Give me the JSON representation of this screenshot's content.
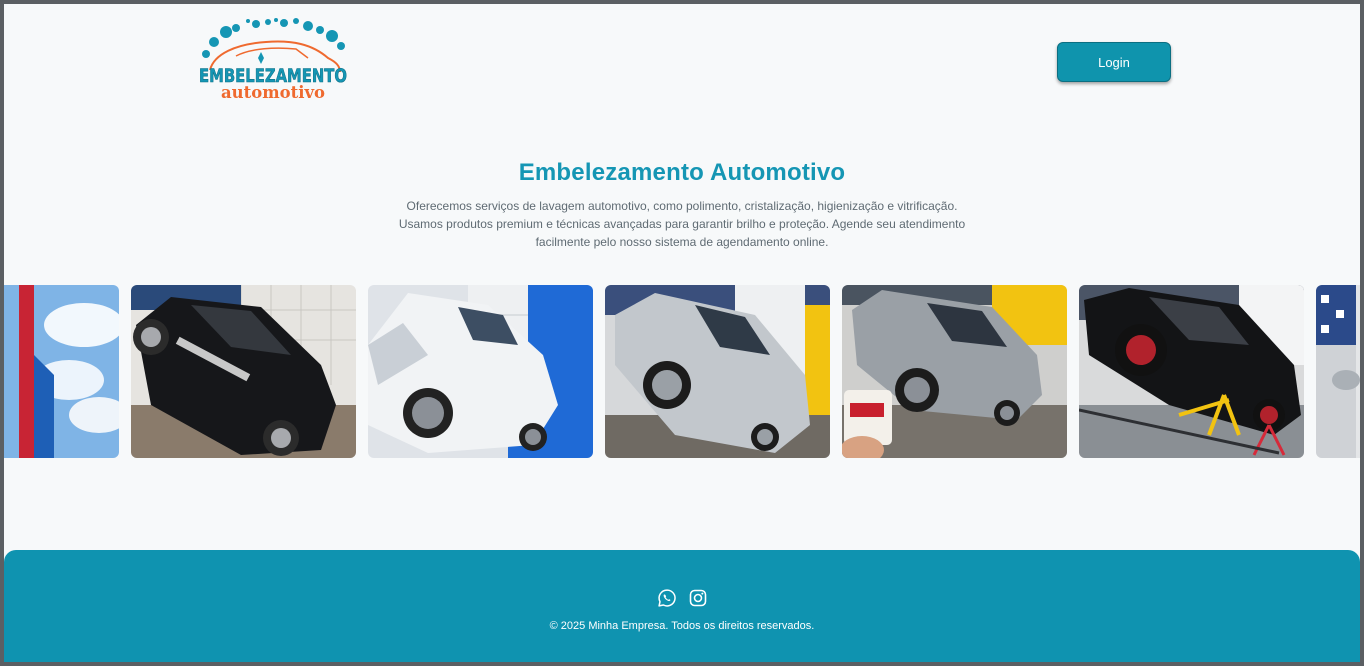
{
  "header": {
    "logo": {
      "text_main": "EMBELEZAMENTO",
      "text_sub": "automotivo"
    },
    "login_label": "Login"
  },
  "hero": {
    "title": "Embelezamento Automotivo",
    "description": "Oferecemos serviços de lavagem automotivo, como polimento, cristalização, higienização e vitrificação. Usamos produtos premium e técnicas avançadas para garantir brilho e proteção. Agende seu atendimento facilmente pelo nosso sistema de agendamento online."
  },
  "carousel": {
    "photos": [
      {
        "name": "red-car-sky"
      },
      {
        "name": "black-hatchback"
      },
      {
        "name": "white-sedan"
      },
      {
        "name": "silver-suv"
      },
      {
        "name": "gray-suv-product"
      },
      {
        "name": "black-suv-stand"
      },
      {
        "name": "partial-car"
      }
    ]
  },
  "footer": {
    "icons": [
      "whatsapp-icon",
      "instagram-icon"
    ],
    "copyright": "© 2025 Minha Empresa. Todos os direitos reservados."
  },
  "colors": {
    "accent": "#0f94ad",
    "title": "#1596b4",
    "footer_bg": "#0f93b0",
    "logo_orange": "#ef6a2f",
    "page_bg": "#f7f9fa"
  }
}
